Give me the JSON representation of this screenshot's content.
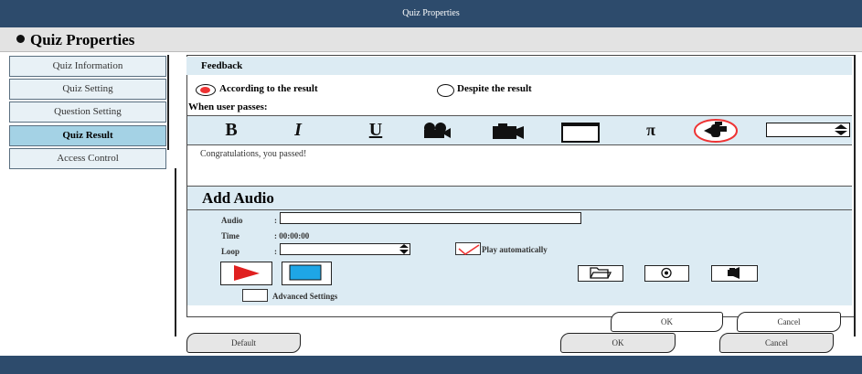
{
  "window": {
    "title": "Quiz Properties"
  },
  "header": {
    "title": "Quiz Properties"
  },
  "sidebar": {
    "items": [
      {
        "label": "Quiz Information"
      },
      {
        "label": "Quiz Setting"
      },
      {
        "label": "Question Setting"
      },
      {
        "label": "Quiz Result",
        "active": true
      },
      {
        "label": "Access Control"
      }
    ]
  },
  "feedback": {
    "section_label": "Feedback",
    "options": [
      {
        "label": "According to the result",
        "selected": true
      },
      {
        "label": "Despite the result",
        "selected": false
      }
    ],
    "when_passes_label": "When user passes:"
  },
  "toolbar": {
    "bold": "B",
    "italic": "I",
    "underline": "U",
    "pi": "π",
    "icons": [
      "bold-icon",
      "italic-icon",
      "underline-icon",
      "video-icon",
      "camera-icon",
      "window-icon",
      "pi-icon",
      "audio-icon",
      "font-size-stepper"
    ]
  },
  "message": {
    "text": "Congratulations, you passed!"
  },
  "audio": {
    "title": "Add Audio",
    "audio_label": "Audio",
    "audio_value": "",
    "time_label": "Time",
    "time_value": ": 00:00:00",
    "loop_label": "Loop",
    "loop_value": "",
    "play_auto_label": "Play automatically",
    "play_auto_checked": true,
    "advanced_label": "Advanced Settings",
    "advanced_checked": false
  },
  "inner_buttons": {
    "ok": "OK",
    "cancel": "Cancel"
  },
  "footer": {
    "default": "Default",
    "ok": "OK",
    "cancel": "Cancel"
  },
  "colors": {
    "titlebar": "#2d4b6c",
    "accent_panel": "#dcebf3",
    "active_nav": "#a4d2e5",
    "radio_selected": "#e33333",
    "play_red": "#e02020",
    "stop_blue": "#1ea6e6"
  }
}
